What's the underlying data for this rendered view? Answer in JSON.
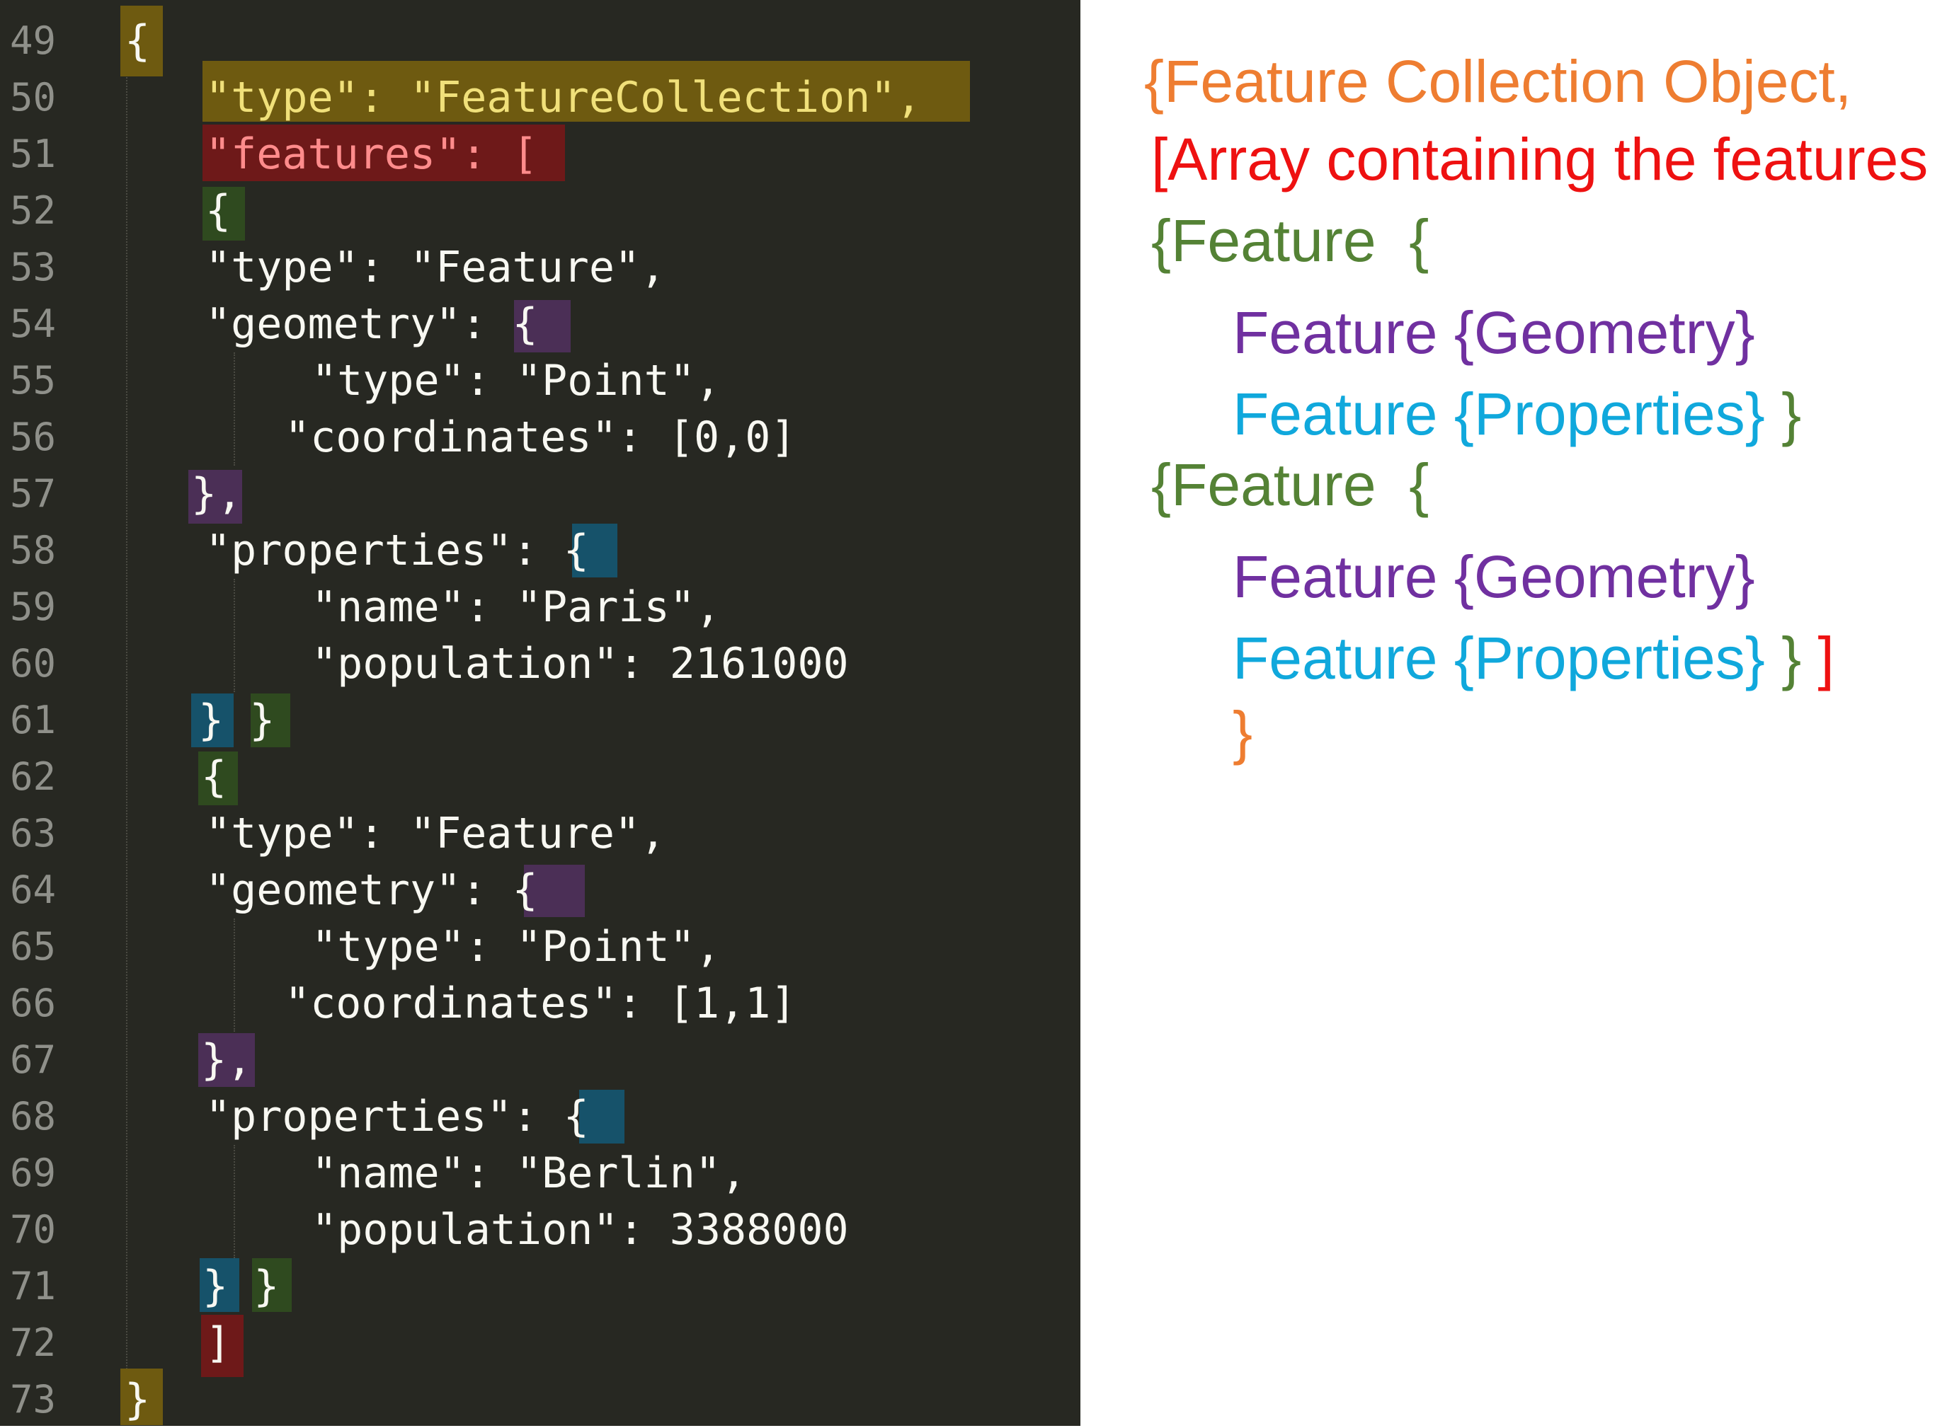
{
  "colors": {
    "editor_bg": "#272822",
    "line_number": "#8f908a",
    "code_text": "#f8f8f2",
    "collection": "#ee7d31",
    "array": "#ee1111",
    "feature": "#548235",
    "geometry": "#7030a0",
    "properties": "#10a8dc"
  },
  "editor": {
    "line_numbers": [
      "49",
      "50",
      "51",
      "52",
      "53",
      "54",
      "55",
      "56",
      "57",
      "58",
      "59",
      "60",
      "61",
      "62",
      "63",
      "64",
      "65",
      "66",
      "67",
      "68",
      "69",
      "70",
      "71",
      "72",
      "73"
    ],
    "lines": [
      "{",
      "\"type\": \"FeatureCollection\",",
      "\"features\": [",
      "{",
      "\"type\": \"Feature\",",
      "\"geometry\": {",
      "\"type\": \"Point\",",
      "\"coordinates\": [0,0]",
      "},",
      "\"properties\": {",
      "\"name\": \"Paris\",",
      "\"population\": 2161000",
      "} }",
      "{",
      "\"type\": \"Feature\",",
      "\"geometry\": {",
      "\"type\": \"Point\",",
      "\"coordinates\": [1,1]",
      "},",
      "\"properties\": {",
      "\"name\": \"Berlin\",",
      "\"population\": 3388000",
      "} }",
      "]",
      "}"
    ]
  },
  "legend": {
    "collection": "{Feature Collection Object,",
    "array": "[Array containing the features",
    "feature1": "{Feature  {",
    "geometry1": "Feature {Geometry}",
    "properties1": "Feature {Properties}",
    "feature1_close": " }",
    "feature2": "{Feature  {",
    "geometry2": "Feature {Geometry}",
    "properties2": "Feature {Properties}",
    "feature2_close": " }",
    "array_close": " ]",
    "collection_close": "}"
  }
}
